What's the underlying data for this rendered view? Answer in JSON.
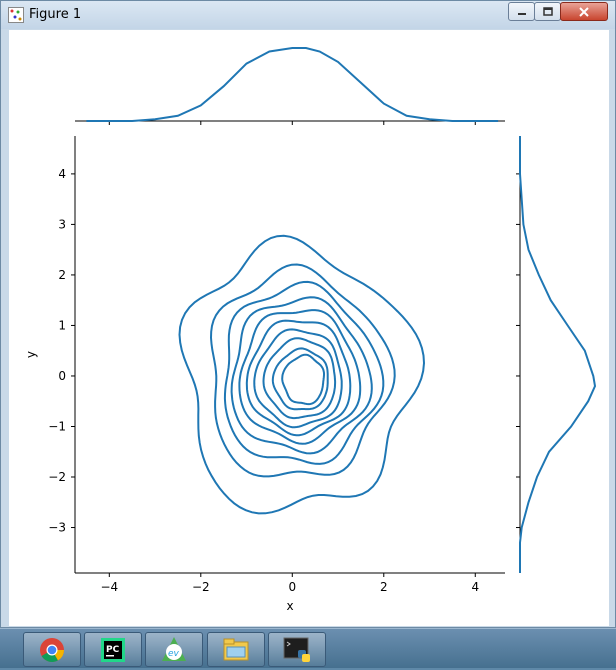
{
  "window": {
    "title": "Figure 1",
    "app_icon": "matplotlib-figure-icon"
  },
  "controls": {
    "minimize": "minimize-icon",
    "maximize": "maximize-icon",
    "close": "close-icon"
  },
  "chart_data": {
    "type": "kde-jointplot",
    "xlabel": "x",
    "ylabel": "y",
    "xlim": [
      -4.75,
      4.65
    ],
    "ylim": [
      -3.9,
      4.75
    ],
    "xticks": [
      -4,
      -2,
      0,
      2,
      4
    ],
    "xtick_labels": [
      "−4",
      "−2",
      "0",
      "2",
      "4"
    ],
    "yticks": [
      -3,
      -2,
      -1,
      0,
      1,
      2,
      3,
      4
    ],
    "ytick_labels": [
      "−3",
      "−2",
      "−1",
      "0",
      "1",
      "2",
      "3",
      "4"
    ],
    "line_color": "#1f77b4",
    "joint_contours": {
      "center": [
        0.1,
        0.0
      ],
      "levels": [
        {
          "rx": 2.5,
          "ry": 2.6,
          "cx": 0.1,
          "cy": -0.05,
          "wiggle": 0.15
        },
        {
          "rx": 1.95,
          "ry": 2.05,
          "cx": 0.1,
          "cy": 0.0,
          "wiggle": 0.12
        },
        {
          "rx": 1.7,
          "ry": 1.75,
          "cx": 0.15,
          "cy": 0.0,
          "wiggle": 0.11
        },
        {
          "rx": 1.5,
          "ry": 1.5,
          "cx": 0.15,
          "cy": 0.0,
          "wiggle": 0.1
        },
        {
          "rx": 1.3,
          "ry": 1.3,
          "cx": 0.15,
          "cy": 0.0,
          "wiggle": 0.09
        },
        {
          "rx": 1.12,
          "ry": 1.12,
          "cx": 0.15,
          "cy": -0.02,
          "wiggle": 0.08
        },
        {
          "rx": 0.95,
          "ry": 0.95,
          "cx": 0.15,
          "cy": -0.05,
          "wiggle": 0.07
        },
        {
          "rx": 0.78,
          "ry": 0.78,
          "cx": 0.18,
          "cy": -0.06,
          "wiggle": 0.06
        },
        {
          "rx": 0.6,
          "ry": 0.6,
          "cx": 0.2,
          "cy": -0.08,
          "wiggle": 0.06
        },
        {
          "rx": 0.45,
          "ry": 0.48,
          "cx": 0.25,
          "cy": -0.08,
          "wiggle": 0.07
        }
      ]
    },
    "marginal_x": {
      "x": [
        -4.5,
        -3.5,
        -3.0,
        -2.5,
        -2.0,
        -1.5,
        -1.0,
        -0.5,
        0.0,
        0.3,
        0.6,
        1.0,
        1.5,
        2.0,
        2.5,
        3.0,
        3.5,
        4.5
      ],
      "density": [
        0.0,
        0.0,
        0.01,
        0.03,
        0.09,
        0.2,
        0.33,
        0.4,
        0.42,
        0.42,
        0.4,
        0.34,
        0.22,
        0.1,
        0.03,
        0.01,
        0.0,
        0.0
      ]
    },
    "marginal_y": {
      "y": [
        -3.9,
        -3.3,
        -3.0,
        -2.5,
        -2.0,
        -1.5,
        -1.0,
        -0.5,
        -0.2,
        0.0,
        0.5,
        1.0,
        1.5,
        2.0,
        2.5,
        3.0,
        4.0,
        4.75
      ],
      "density": [
        0.0,
        0.0,
        0.01,
        0.05,
        0.1,
        0.17,
        0.3,
        0.4,
        0.44,
        0.43,
        0.38,
        0.28,
        0.18,
        0.11,
        0.05,
        0.02,
        0.0,
        0.0
      ]
    }
  },
  "taskbar": {
    "items": [
      {
        "icon": "chrome-icon"
      },
      {
        "icon": "pycharm-icon"
      },
      {
        "icon": "ev-recorder-icon"
      },
      {
        "icon": "file-explorer-icon"
      },
      {
        "icon": "python-icon"
      }
    ]
  }
}
